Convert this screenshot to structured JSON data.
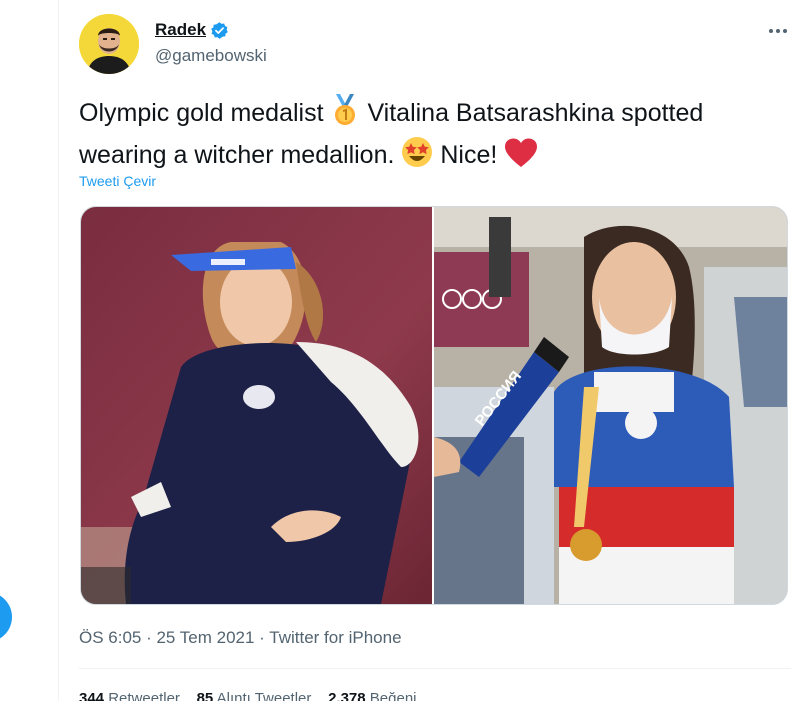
{
  "author": {
    "display_name": "Radek",
    "handle": "@gamebowski",
    "verified": true
  },
  "tweet": {
    "text_part1": "Olympic gold medalist",
    "text_part2": "Vitalina Batsarashkina spotted wearing a witcher medallion.",
    "text_part3": "Nice!",
    "translate_label": "Tweeti Çevir"
  },
  "media": {
    "right_photo_mic_text": "РОССИЯ",
    "cap_text": "ROC"
  },
  "meta": {
    "timestamp": "ÖS 6:05 · 25 Tem 2021 · Twitter for iPhone"
  },
  "stats": {
    "retweets_count": "344",
    "retweets_label": "Retweetler",
    "quotes_count": "85",
    "quotes_label": "Alıntı Tweetler",
    "likes_count": "2.378",
    "likes_label": "Beğeni"
  },
  "colors": {
    "accent": "#1d9bf0",
    "text_primary": "#0f1419",
    "text_secondary": "#536471"
  }
}
